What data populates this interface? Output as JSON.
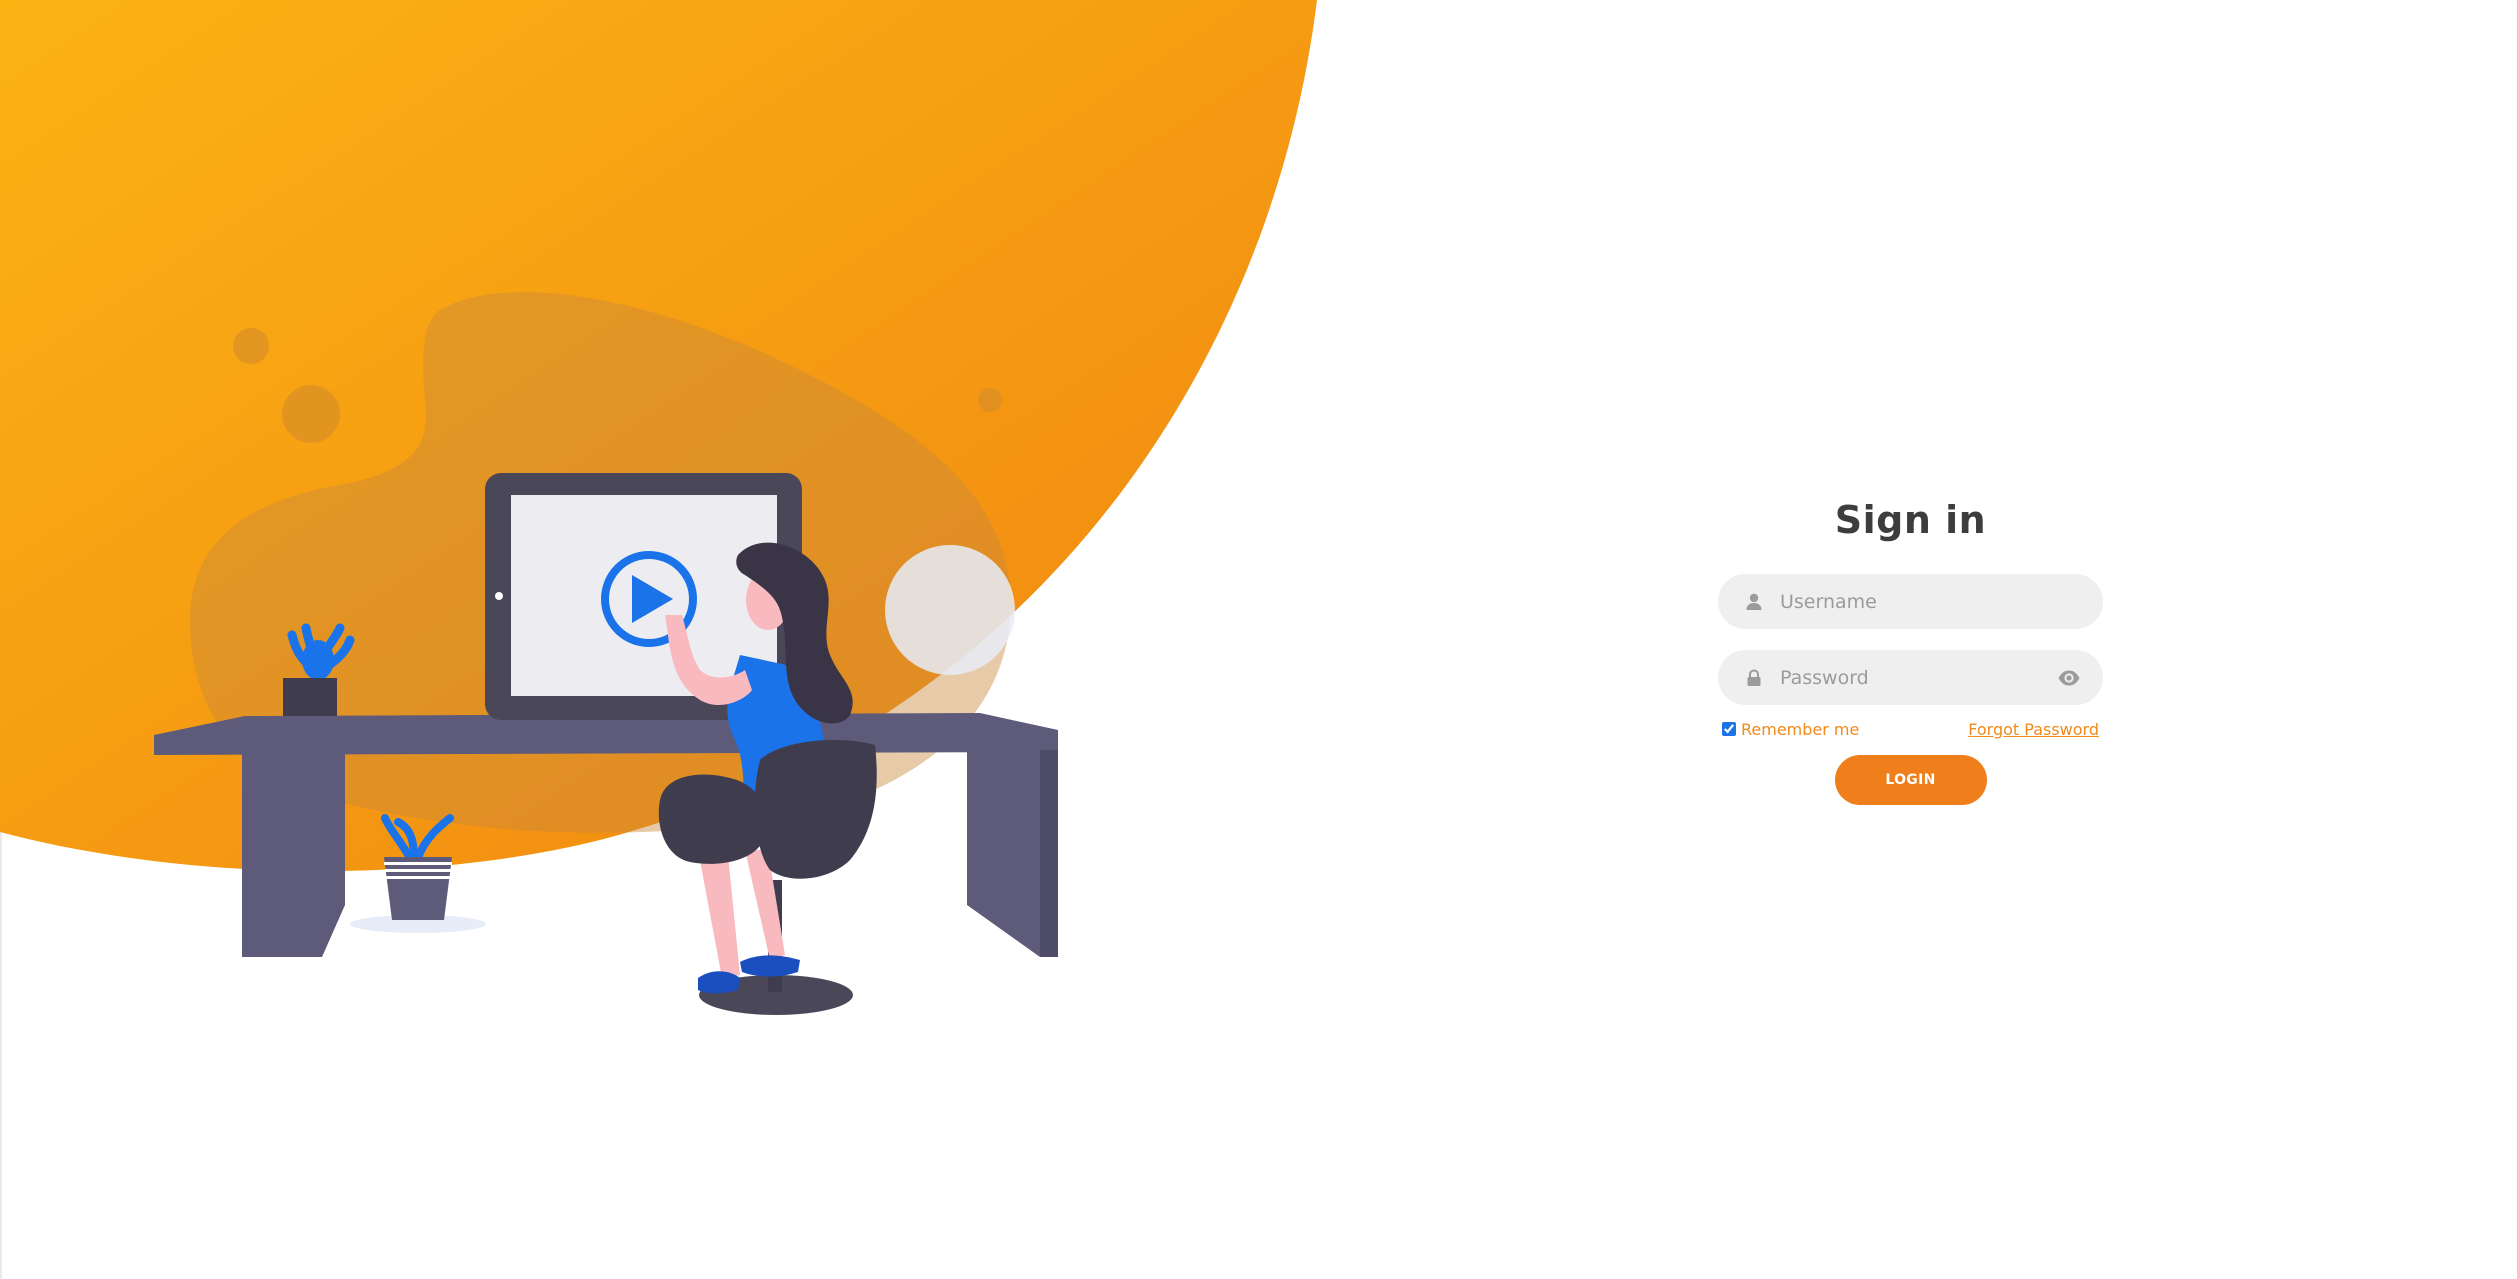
{
  "signin": {
    "title": "Sign in",
    "username": {
      "placeholder": "Username",
      "value": "",
      "icon": "user-icon"
    },
    "password": {
      "placeholder": "Password",
      "value": "",
      "icon": "lock-icon",
      "toggle_icon": "eye-icon"
    },
    "remember_label": "Remember me",
    "remember_checked": true,
    "forgot_label": "Forgot Password",
    "login_label": "LOGIN"
  },
  "illustration": {
    "play_icon": "play-icon"
  },
  "colors": {
    "accent": "#ee7f1b",
    "gradient_start": "#fbb314",
    "gradient_end": "#f08410",
    "title": "#3d3d3d",
    "field_background": "#efefef",
    "illustration_blue": "#1a73e8",
    "furniture": "#5d5a7a"
  }
}
